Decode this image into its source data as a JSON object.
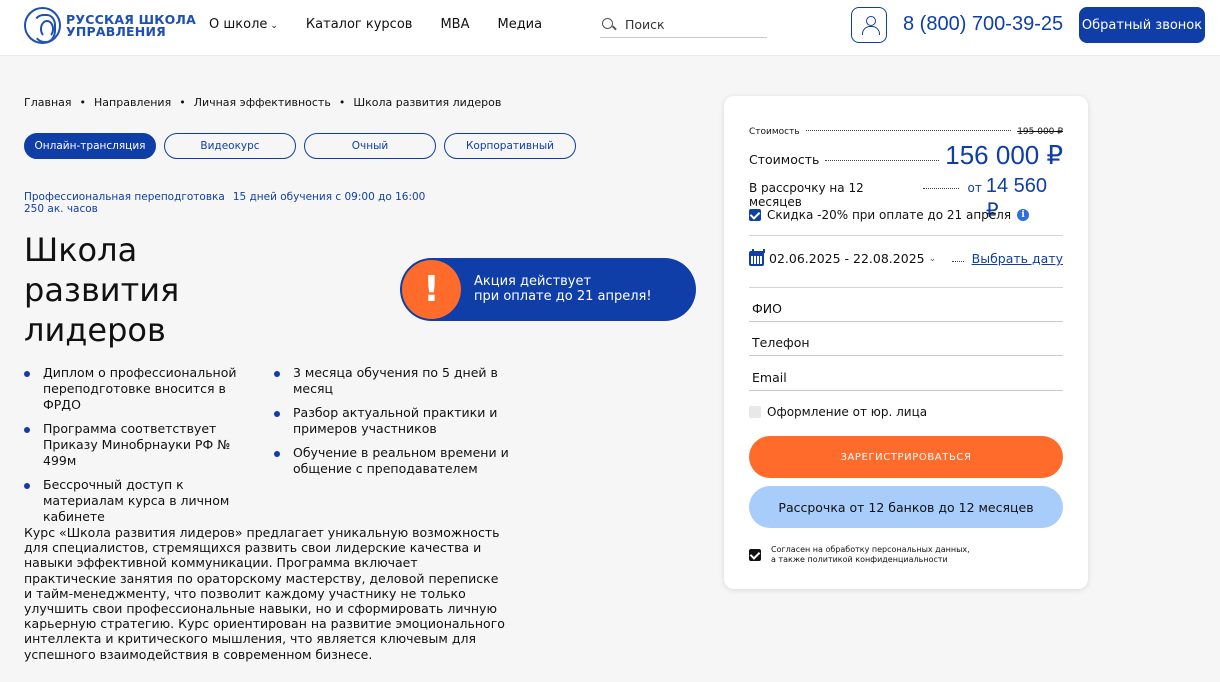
{
  "header": {
    "logo_line1": "РУССКАЯ ШКОЛА",
    "logo_line2": "УПРАВЛЕНИЯ",
    "nav": [
      {
        "label": "О школе",
        "has_dropdown": true
      },
      {
        "label": "Каталог курсов"
      },
      {
        "label": "MBA"
      },
      {
        "label": "Медиа"
      }
    ],
    "search_placeholder": "Поиск",
    "phone": "8 (800) 700-39-25",
    "callback_label": "Обратный звонок"
  },
  "breadcrumb": [
    "Главная",
    "Направления",
    "Личная эффективность",
    "Школа развития лидеров"
  ],
  "breadcrumb_separator": "•",
  "tabs": [
    {
      "label": "Онлайн-трансляция",
      "active": true
    },
    {
      "label": "Видеокурс"
    },
    {
      "label": "Очный"
    },
    {
      "label": "Корпоративный"
    }
  ],
  "meta": {
    "program_type": "Профессиональная переподготовка",
    "schedule": "15 дней обучения с 09:00 до 16:00",
    "hours": "250 ак. часов"
  },
  "title": {
    "line1": "Школа",
    "line2": "развития",
    "line3": "лидеров"
  },
  "promo": {
    "alert_glyph": "!",
    "line1": "Акция действует",
    "line2": "при оплате до 21 апреля!"
  },
  "features_left": [
    "Диплом о профессиональной переподготовке вносится в ФРДО",
    "Программа соответствует Приказу Минобрнауки РФ № 499м",
    "Бессрочный доступ к материалам курса в личном кабинете"
  ],
  "features_right": [
    "3 месяца обучения по 5 дней в месяц",
    "Разбор актуальной практики и примеров участников",
    "Обучение в реальном времени и общение с преподавателем"
  ],
  "description": "Курс «Школа развития лидеров» предлагает уникальную возможность для специалистов, стремящихся развить свои лидерские качества и навыки эффективной коммуникации. Программа включает практические занятия по ораторскому мастерству, деловой переписке и тайм-менеджменту, что позволит каждому участнику не только улучшить свои профессиональные навыки, но и сформировать личную карьерную стратегию. Курс ориентирован на развитие эмоционального интеллекта и критического мышления, что является ключевым для успешного взаимодействия в современном бизнесе.",
  "card": {
    "old_price_label": "Стоимость",
    "old_price": "195 000 ₽",
    "price_label": "Стоимость",
    "price": "156 000 ₽",
    "installment_label": "В рассрочку на 12 месяцев",
    "installment_from": "от",
    "installment_price": "14 560 ₽",
    "discount": "Скидка -20% при оплате до 21 апреля",
    "info_glyph": "i",
    "dates": "02.06.2025 - 22.08.2025",
    "pick_date": "Выбрать дату",
    "name_placeholder": "ФИО",
    "phone_placeholder": "Телефон",
    "email_placeholder": "Email",
    "legal_entity": "Оформление от юр. лица",
    "register_label": "ЗАРЕГИСТРИРОВАТЬСЯ",
    "installment_button": "Рассрочка от 12 банков до 12 месяцев",
    "consent_line1": "Согласен на обработку персональных данных,",
    "consent_line2": "а также политикой конфиденциальности"
  },
  "colors": {
    "brand_blue": "#0f3ea8",
    "accent_orange": "#ff6b2b",
    "light_blue": "#a9cdfb",
    "background": "#f6f6f6"
  }
}
